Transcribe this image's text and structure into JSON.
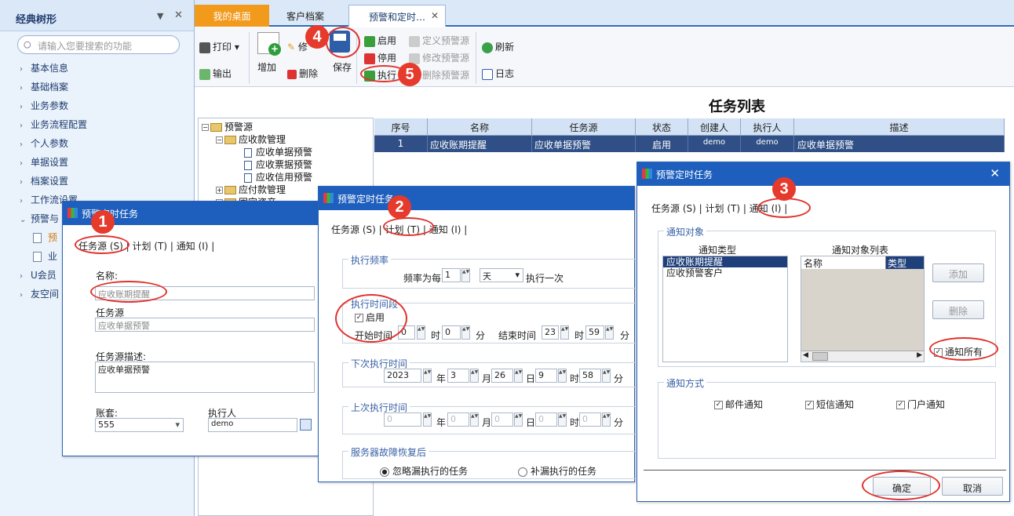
{
  "nav": {
    "title": "经典树形",
    "search_placeholder": "请输入您要搜索的功能",
    "items": [
      "基本信息",
      "基础档案",
      "业务参数",
      "业务流程配置",
      "个人参数",
      "单据设置",
      "档案设置",
      "工作流设置",
      "预警与",
      "U会员",
      "友空间"
    ],
    "subitems": [
      "预",
      "业"
    ]
  },
  "tabs": [
    "我的桌面",
    "客户档案",
    "预警和定时…"
  ],
  "toolbar": {
    "print": "打印",
    "export": "输出",
    "add": "增加",
    "edit": "修",
    "delete": "删除",
    "save": "保存",
    "enable": "启用",
    "disable": "停用",
    "execute": "执行",
    "define_source": "定义预警源",
    "modify_source": "修改预警源",
    "delete_source": "删除预警源",
    "refresh": "刷新",
    "log": "日志"
  },
  "list": {
    "title": "任务列表",
    "columns": [
      "序号",
      "名称",
      "任务源",
      "状态",
      "创建人",
      "执行人",
      "描述"
    ],
    "rows": [
      [
        "1",
        "应收账期提醒",
        "应收单据预警",
        "启用",
        "demo",
        "demo",
        "应收单据预警"
      ]
    ]
  },
  "tree": {
    "root": "预警源",
    "n1": "应收款管理",
    "n1a": "应收单据预警",
    "n1b": "应收票据预警",
    "n1c": "应收信用预警",
    "n2": "应付款管理",
    "n3": "固定资产"
  },
  "dialog_title": "预警定时任务",
  "tabs_labels": {
    "source": "任务源",
    "source_key": "(S)",
    "plan": "计划",
    "plan_key": "(T)",
    "notify": "通知",
    "notify_key": "(I)"
  },
  "d1": {
    "name_label": "名称:",
    "name_value": "应收账期提醒",
    "source_label": "任务源",
    "source_value": "应收单据预警",
    "desc_label": "任务源描述:",
    "desc_value": "应收单据预警",
    "account_label": "账套:",
    "account_value": "555",
    "executor_label": "执行人",
    "executor_value": "demo"
  },
  "d2": {
    "freq_group": "执行频率",
    "freq_prefix": "频率为每",
    "freq_num": "1",
    "freq_unit": "天",
    "freq_suffix": "执行一次",
    "period_group": "执行时间段",
    "enable": "启用",
    "start_label": "开始时间",
    "start_h": "0",
    "start_m": "0",
    "hour": "时",
    "min": "分",
    "end_label": "结束时间",
    "end_h": "23",
    "end_m": "59",
    "next_group": "下次执行时间",
    "next_year": "2023",
    "next_month": "3",
    "next_day": "26",
    "next_hour": "9",
    "next_min": "58",
    "year": "年",
    "month": "月",
    "day": "日",
    "last_group": "上次执行时间",
    "last_year": "0",
    "last_month": "0",
    "last_day": "0",
    "last_hour": "0",
    "last_min": "0",
    "recover_group": "服务器故障恢复后",
    "opt1": "忽略漏执行的任务",
    "opt2": "补漏执行的任务"
  },
  "d3": {
    "target_group": "通知对象",
    "type_label": "通知类型",
    "list_label": "通知对象列表",
    "types": [
      "应收账期提醒",
      "应收预警客户"
    ],
    "col_name": "名称",
    "col_type": "类型",
    "add": "添加",
    "delete": "删除",
    "notify_all": "通知所有",
    "method_group": "通知方式",
    "mail": "邮件通知",
    "sms": "短信通知",
    "portal": "门户通知",
    "ok": "确定",
    "cancel": "取消"
  },
  "markers": [
    "1",
    "2",
    "3",
    "4",
    "5"
  ],
  "colors": {
    "accent_orange": "#f29a1c",
    "title_blue": "#1e5fbd",
    "marker_red": "#e53a2c"
  }
}
